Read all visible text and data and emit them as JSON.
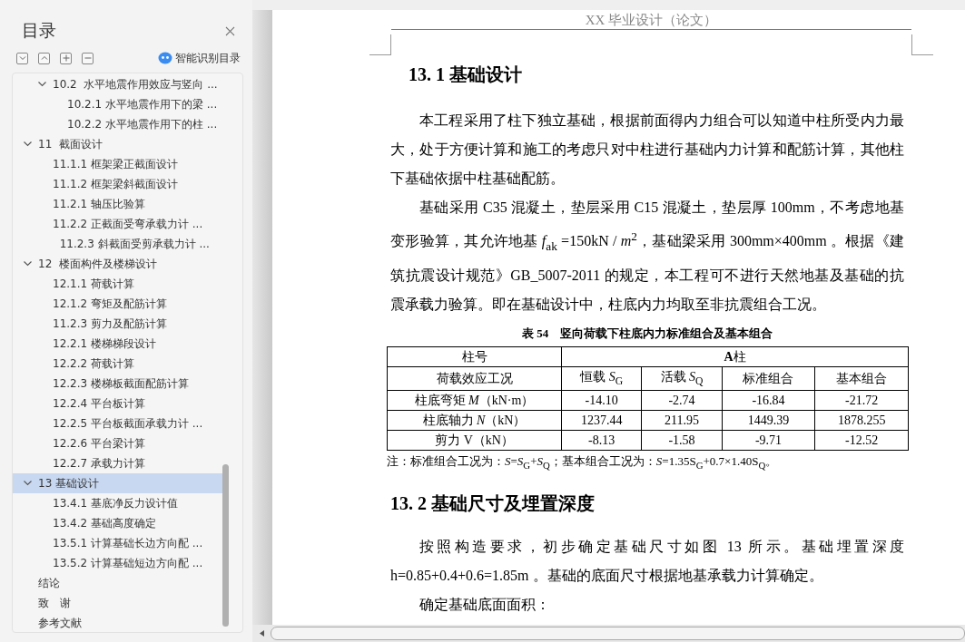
{
  "sidebar": {
    "title": "目录",
    "smart_toc_button": "智能识别目录",
    "toc": {
      "items": [
        {
          "children": [
            {
              "label": "10.2  水平地震作用效应与竖向 ...",
              "expanded": true,
              "selected": false,
              "children": [
                {
                  "label": "10.2.1 水平地震作用下的梁 ...",
                  "selected": false
                },
                {
                  "label": "10.2.2 水平地震作用下的柱 ...",
                  "selected": false
                }
              ]
            }
          ]
        },
        {
          "label": "11  截面设计",
          "expanded": true,
          "selected": false,
          "children": [
            {
              "label": "11.1.1 框架梁正截面设计",
              "selected": false
            },
            {
              "label": "11.1.2 框架梁斜截面设计",
              "selected": false
            },
            {
              "label": "11.2.1 轴压比验算",
              "selected": false
            },
            {
              "label": "11.2.2 正截面受弯承载力计 ...",
              "selected": false
            },
            {
              "label": "  11.2.3 斜截面受剪承载力计 ...",
              "selected": false
            }
          ]
        },
        {
          "label": "12  楼面构件及楼梯设计",
          "expanded": true,
          "selected": false,
          "children": [
            {
              "label": "12.1.1 荷载计算",
              "selected": false
            },
            {
              "label": "12.1.2 弯矩及配筋计算",
              "selected": false
            },
            {
              "label": "11.2.3 剪力及配筋计算",
              "selected": false
            },
            {
              "label": "12.2.1 楼梯梯段设计",
              "selected": false
            },
            {
              "label": "12.2.2 荷载计算",
              "selected": false
            },
            {
              "label": "12.2.3 楼梯板截面配筋计算",
              "selected": false
            },
            {
              "label": "12.2.4 平台板计算",
              "selected": false
            },
            {
              "label": "12.2.5 平台板截面承载力计 ...",
              "selected": false
            },
            {
              "label": "12.2.6 平台梁计算",
              "selected": false
            },
            {
              "label": "12.2.7 承载力计算",
              "selected": false
            }
          ]
        },
        {
          "label": "13 基础设计",
          "expanded": true,
          "selected": true,
          "children": [
            {
              "label": "13.4.1 基底净反力设计值",
              "selected": false
            },
            {
              "label": "13.4.2 基础高度确定",
              "selected": false
            },
            {
              "label": "13.5.1 计算基础长边方向配 ...",
              "selected": false
            },
            {
              "label": "13.5.2 计算基础短边方向配 ...",
              "selected": false
            }
          ]
        },
        {
          "label": "结论",
          "selected": false
        },
        {
          "label": "致　谢",
          "selected": false
        },
        {
          "label": "参考文献",
          "selected": false
        }
      ]
    }
  },
  "document": {
    "header": "XX 毕业设计（论文）",
    "blocks": [
      {
        "kind": "heading",
        "text": "13. 1 基础设计"
      },
      {
        "kind": "paragraph",
        "text": "本工程采用了柱下独立基础，根据前面得内力组合可以知道中柱所受内力最大，处于方便计算和施工的考虑只对中柱进行基础内力计算和配筋计算，其他柱下基础依据中柱基础配筋。"
      },
      {
        "kind": "paragraph",
        "text": "基础采用 C35 混凝土，垫层采用 C15 混凝土，垫层厚 100mm，不考虑地基变形验算，其允许地基 *f*$_{ak}$ =150kN / *m*$^{2}$，基础梁采用 300mm×400mm 。根据《建筑抗震设计规范》GB_5007-2011 的规定，本工程可不进行天然地基及基础的抗震承载力验算。即在基础设计中，柱底内力均取至非抗震组合工况。"
      },
      {
        "kind": "caption",
        "text": "表 54　竖向荷载下柱底内力标准组合及基本组合"
      },
      {
        "kind": "table",
        "rows": [
          [
            "柱号",
            {
              "text": "**A**柱",
              "colspan": 4
            }
          ],
          [
            "荷载效应工况",
            "恒载 *S*$_{G}$",
            "活载 *S*$_{Q}$",
            "标准组合",
            "基本组合"
          ],
          [
            "柱底弯矩 *M*（kN·m）",
            "-14.10",
            "-2.74",
            "-16.84",
            "-21.72"
          ],
          [
            "柱底轴力 *N*（kN）",
            "1237.44",
            "211.95",
            "1449.39",
            "1878.255"
          ],
          [
            "剪力 V（kN）",
            "-8.13",
            "-1.58",
            "-9.71",
            "-12.52"
          ]
        ]
      },
      {
        "kind": "note",
        "text": "注：标准组合工况为：*S*=*S*$_{G}$+*S*$_{Q}$；基本组合工况为：*S*=1.35S$_{G}$+0.7×1.40S$_{Q}$。"
      },
      {
        "kind": "heading",
        "text": "13. 2 基础尺寸及埋置深度"
      },
      {
        "kind": "paragraph",
        "text": "按照构造要求，初步确定基础尺寸如图 13 所示。基础埋置深度 h=0.85+0.4+0.6=1.85m 。基础的底面尺寸根据地基承载力计算确定。"
      },
      {
        "kind": "paragraph",
        "text": "确定基础底面面积："
      }
    ]
  }
}
